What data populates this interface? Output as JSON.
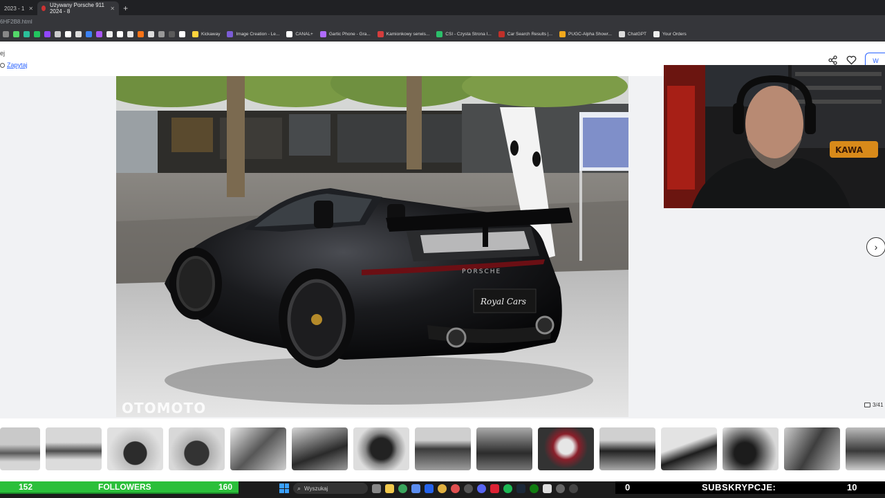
{
  "browser": {
    "tabs": [
      {
        "label": "2023 - 1",
        "active": false
      },
      {
        "label": "Używany Porsche 911 2024 - 8",
        "active": true
      }
    ],
    "new_tab": "+",
    "url": "6HF2B8.html",
    "bookmarks": [
      {
        "label": "Kickaway",
        "color": "#ffd33d"
      },
      {
        "label": "Image Creation - Le...",
        "color": "#7b5cd6"
      },
      {
        "label": "CANAL+",
        "color": "#ffffff"
      },
      {
        "label": "Gartic Phone - Gra...",
        "color": "#b06bff"
      },
      {
        "label": "Kamionkowy serwis...",
        "color": "#d43d3d"
      },
      {
        "label": "CSI - Czysta Strona I...",
        "color": "#2bbf6a"
      },
      {
        "label": "Car Search Results |...",
        "color": "#c0302a"
      },
      {
        "label": "PUGC-Alpha Showr...",
        "color": "#f2a81c"
      },
      {
        "label": "ChatGPT",
        "color": "#dddddd"
      },
      {
        "label": "Your Orders",
        "color": "#eeeeee"
      }
    ]
  },
  "listing": {
    "breadcrumb_tail": "ej",
    "ask_link": "Zapytaj",
    "watermark": "OTOMOTO",
    "plate_text": "Royal Cars",
    "photo_counter": "3/41",
    "next_arrow": "›",
    "action_button": "W",
    "share_icon": "share-icon",
    "heart_icon": "heart-icon"
  },
  "stream": {
    "followers_current": "152",
    "followers_label": "FOLLOWERS",
    "followers_goal": "160",
    "followers_progress": 0.95,
    "subs_current": "0",
    "subs_label": "SUBSKRYPCJE:",
    "subs_goal": "10",
    "webcam_text": "KAWA"
  },
  "taskbar": {
    "search_placeholder": "Wyszukaj"
  }
}
